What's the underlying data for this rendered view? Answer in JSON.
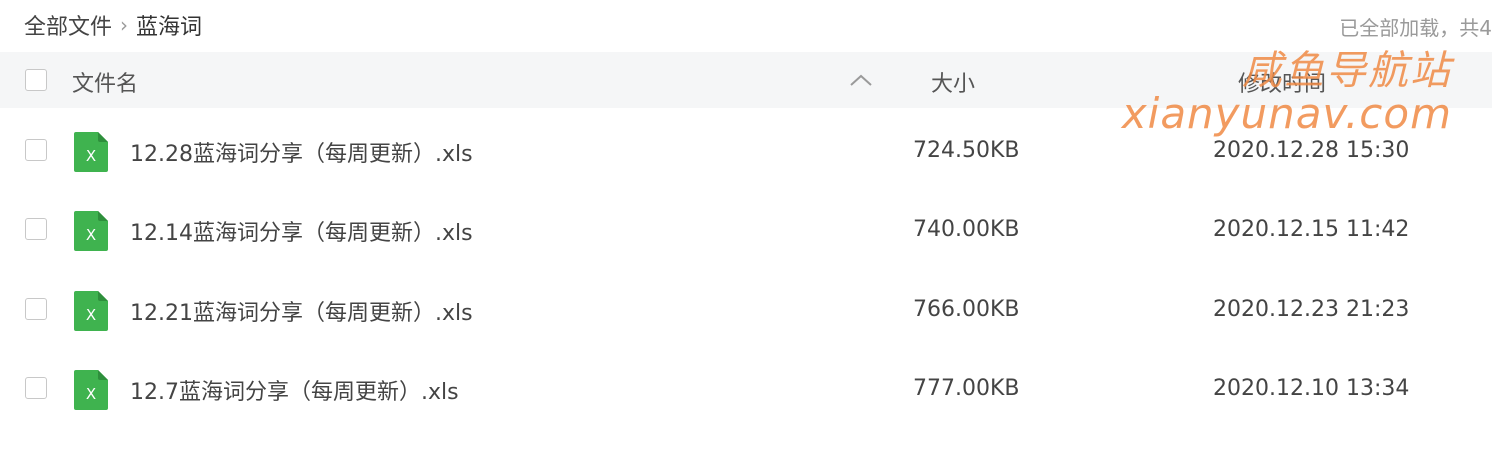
{
  "breadcrumb": {
    "root": "全部文件",
    "separator": "›",
    "current": "蓝海词"
  },
  "status": {
    "load_text": "已全部加载，共4"
  },
  "table": {
    "header": {
      "name": "文件名",
      "size": "大小",
      "modified": "修改时间",
      "sort_icon": "chevron-up-icon"
    },
    "rows": [
      {
        "name": "12.28蓝海词分享（每周更新）.xls",
        "size": "724.50KB",
        "modified": "2020.12.28 15:30",
        "icon": "excel-file-icon"
      },
      {
        "name": "12.14蓝海词分享（每周更新）.xls",
        "size": "740.00KB",
        "modified": "2020.12.15 11:42",
        "icon": "excel-file-icon"
      },
      {
        "name": "12.21蓝海词分享（每周更新）.xls",
        "size": "766.00KB",
        "modified": "2020.12.23 21:23",
        "icon": "excel-file-icon"
      },
      {
        "name": "12.7蓝海词分享（每周更新）.xls",
        "size": "777.00KB",
        "modified": "2020.12.10 13:34",
        "icon": "excel-file-icon"
      }
    ]
  },
  "watermark": {
    "line1": "咸鱼导航站",
    "line2": "xianyunav.com"
  },
  "colors": {
    "header_bg": "#f5f6f7",
    "excel_green": "#3fb34f",
    "watermark_orange": "#f08a45",
    "muted_text": "#9a9a9a"
  }
}
